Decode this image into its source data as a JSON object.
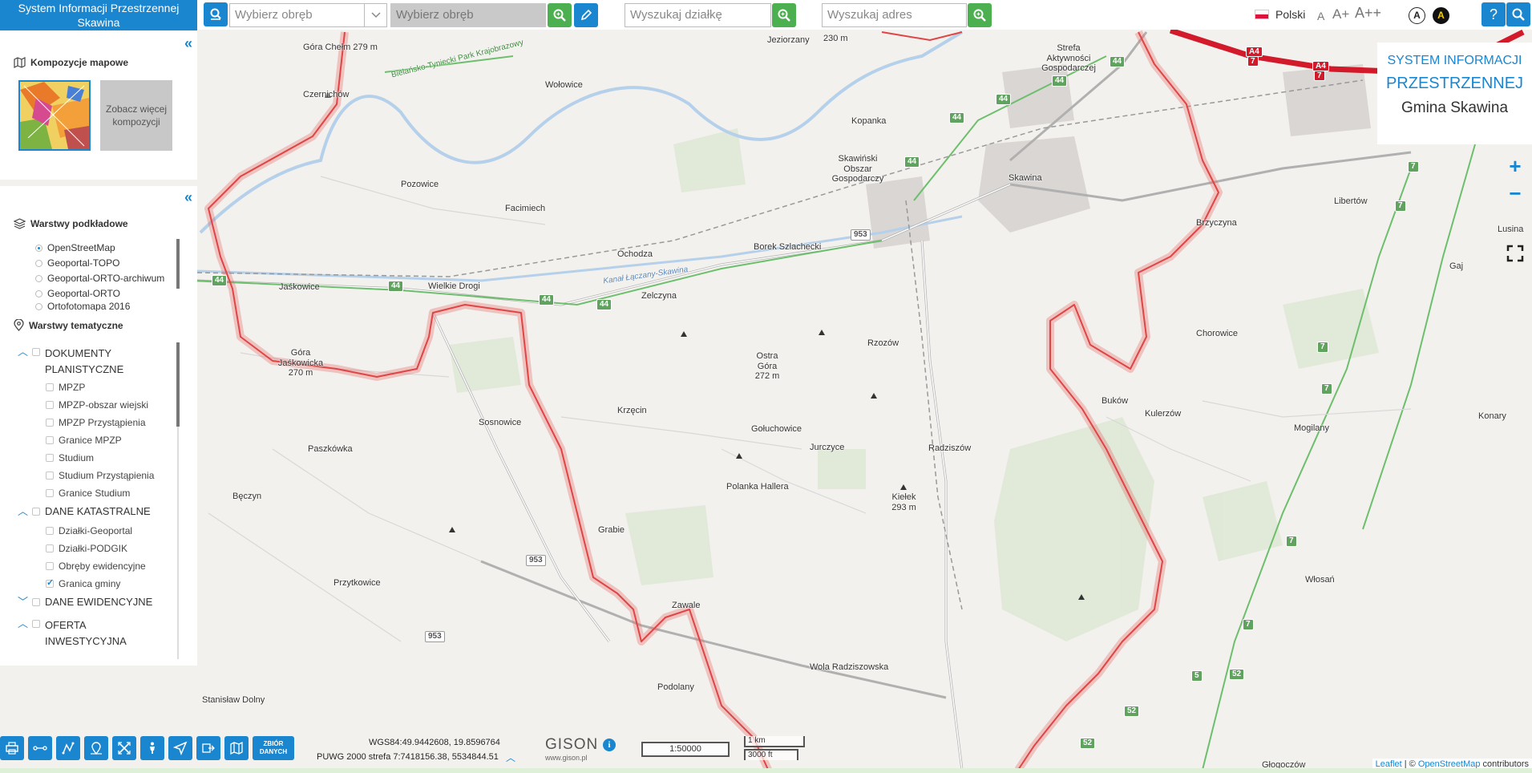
{
  "app": {
    "brand_line1": "System Informacji Przestrzennej",
    "brand_line2": "Skawina"
  },
  "toolbar": {
    "obreb_select_placeholder": "Wybierz obręb",
    "obreb_input_placeholder": "Wybierz obręb",
    "dzialka_placeholder": "Wyszukaj działkę",
    "adres_placeholder": "Wyszukaj adres",
    "language": "Polski",
    "font_small": "A",
    "font_medium": "A+",
    "font_large": "A++",
    "contrast_normal": "A",
    "contrast_high": "A",
    "help": "?"
  },
  "compositions": {
    "title": "Kompozycje mapowe",
    "more_label": "Zobacz więcej kompozycji"
  },
  "base_layers": {
    "title": "Warstwy podkładowe",
    "items": [
      {
        "label": "OpenStreetMap",
        "selected": true
      },
      {
        "label": "Geoportal-TOPO",
        "selected": false
      },
      {
        "label": "Geoportal-ORTO-archiwum",
        "selected": false
      },
      {
        "label": "Geoportal-ORTO",
        "selected": false
      },
      {
        "label": "Ortofotomapa 2016",
        "selected": false
      }
    ]
  },
  "thematic_layers": {
    "title": "Warstwy tematyczne",
    "groups": [
      {
        "label": "DOKUMENTY PLANISTYCZNE",
        "expanded": true,
        "items": [
          {
            "label": "MPZP",
            "checked": false
          },
          {
            "label": "MPZP-obszar wiejski",
            "checked": false
          },
          {
            "label": "MPZP Przystąpienia",
            "checked": false
          },
          {
            "label": "Granice MPZP",
            "checked": false
          },
          {
            "label": "Studium",
            "checked": false
          },
          {
            "label": "Studium Przystąpienia",
            "checked": false
          },
          {
            "label": "Granice Studium",
            "checked": false
          }
        ]
      },
      {
        "label": "DANE KATASTRALNE",
        "expanded": true,
        "items": [
          {
            "label": "Działki-Geoportal",
            "checked": false
          },
          {
            "label": "Działki-PODGIK",
            "checked": false
          },
          {
            "label": "Obręby ewidencyjne",
            "checked": false
          },
          {
            "label": "Granica gminy",
            "checked": true
          }
        ]
      },
      {
        "label": "DANE EWIDENCYJNE",
        "expanded": false,
        "items": []
      },
      {
        "label": "OFERTA INWESTYCYJNA",
        "expanded": true,
        "items": []
      }
    ]
  },
  "info_box": {
    "line1": "SYSTEM INFORMACJI",
    "line2": "PRZESTRZENNEJ",
    "line3": "Gmina Skawina"
  },
  "map_controls": {
    "zoom_in": "+",
    "zoom_out": "−"
  },
  "map_labels": {
    "gora_chelm": "Góra Chełm 279 m",
    "park": "Bielańsko-Tyniecki Park Krajobrazowy",
    "wolowice": "Wołowice",
    "czernichow": "Czernichów",
    "pozowice": "Pozowice",
    "facimiech": "Facimiech",
    "ochodza": "Ochodza",
    "jezdorzany": "Jeziorzany",
    "h230": "230 m",
    "kopanka": "Kopanka",
    "strefa": "Strefa Aktywności Gospodarczej",
    "sog": "Skawiński Obszar Gospodarczy",
    "skawina": "Skawina",
    "borek": "Borek Szlachecki",
    "jaskowice": "Jaśkowice",
    "wielkie_drogi": "Wielkie Drogi",
    "zelczyna": "Zelczyna",
    "kanal": "Kanał Łączany-Skawina",
    "gora_jaskowicka": "Góra Jaśkowicka 270 m",
    "ostra_gora": "Ostra Góra 272 m",
    "rzozow": "Rzozów",
    "krzecin": "Krzęcin",
    "sosnowice": "Sosnowice",
    "paszkowka": "Paszkówka",
    "goluchowice": "Gołuchowice",
    "jurczyce": "Jurczyce",
    "radziszow": "Radziszów",
    "polanka": "Polanka Hallera",
    "kielek": "Kiełek 293 m",
    "beczyn": "Bęczyn",
    "grabie": "Grabie",
    "przytkowice": "Przytkowice",
    "zawale": "Zawale",
    "wola": "Wola Radziszowska",
    "podolany": "Podolany",
    "stanislaw": "Stanisław Dolny",
    "brzyczyna": "Brzyczyna",
    "libertow": "Libertów",
    "lusina": "Lusina",
    "gaj": "Gaj",
    "chorowice": "Chorowice",
    "bukow": "Buków",
    "kulerzow": "Kulerzów",
    "mogilany": "Mogilany",
    "konary": "Konary",
    "wlosan": "Włosań",
    "glogoczow": "Głogoczów"
  },
  "road_shields": {
    "a4": "A4",
    "e7": "7",
    "r44": "44",
    "r953": "953",
    "r7": "7",
    "r52": "52",
    "r5": "5"
  },
  "bottom": {
    "wgs84": "WGS84:49.9442608, 19.8596764",
    "puwg": "PUWG 2000 strefa 7:7418156.38, 5534844.51",
    "gison_name": "GISON",
    "gison_url": "www.gison.pl",
    "scale": "1:50000",
    "scale_km": "1 km",
    "scale_ft": "3000 ft",
    "zbior_danych": "ZBIÓR DANYCH",
    "attribution_leaflet": "Leaflet",
    "attribution_sep": " | © ",
    "attribution_osm": "OpenStreetMap",
    "attribution_suffix": " contributors"
  },
  "colors": {
    "accent": "#1a86d0",
    "search_green": "#4caf50",
    "border_red": "#e04545",
    "river": "#b5d0ea"
  }
}
